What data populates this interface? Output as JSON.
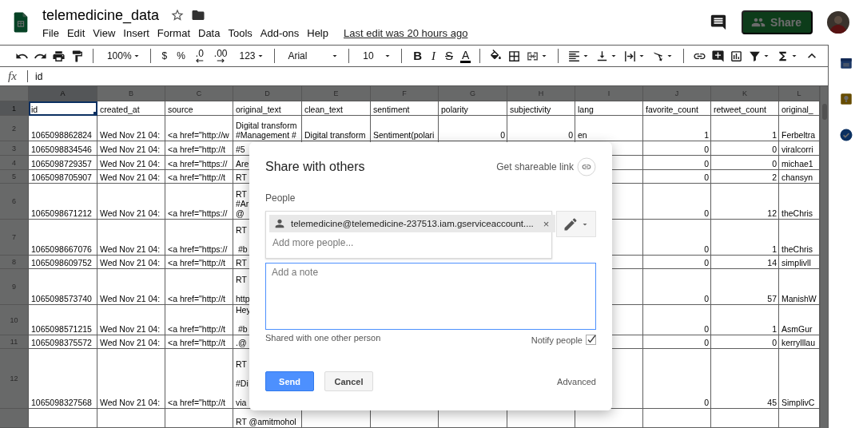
{
  "document": {
    "title": "telemedicine_data",
    "menus": [
      "File",
      "Edit",
      "View",
      "Insert",
      "Format",
      "Data",
      "Tools",
      "Add-ons",
      "Help"
    ],
    "last_edit": "Last edit was 20 hours ago",
    "share_label": "Share"
  },
  "toolbar": {
    "zoom": "100%",
    "currency": "$",
    "percent": "%",
    "decrease_decimals": ".0",
    "increase_decimals": ".00",
    "number_format": "123",
    "font": "Arial",
    "font_size": "10",
    "bold": "B",
    "italic": "I",
    "strikethrough": "S",
    "text_color": "A"
  },
  "formula_bar": {
    "fx": "fx",
    "value": "id"
  },
  "sheet": {
    "columns": [
      {
        "letter": "A",
        "selected": true,
        "kind": "text"
      },
      {
        "letter": "B",
        "selected": false,
        "kind": "text"
      },
      {
        "letter": "C",
        "selected": false,
        "kind": "text"
      },
      {
        "letter": "D",
        "selected": false,
        "kind": "text"
      },
      {
        "letter": "E",
        "selected": false,
        "kind": "text"
      },
      {
        "letter": "F",
        "selected": false,
        "kind": "text"
      },
      {
        "letter": "G",
        "selected": false,
        "kind": "number"
      },
      {
        "letter": "H",
        "selected": false,
        "kind": "number"
      },
      {
        "letter": "I",
        "selected": false,
        "kind": "text"
      },
      {
        "letter": "J",
        "selected": false,
        "kind": "number"
      },
      {
        "letter": "K",
        "selected": false,
        "kind": "number"
      },
      {
        "letter": "L",
        "selected": false,
        "kind": "text"
      }
    ],
    "rows": [
      {
        "number": "1",
        "selected": true,
        "kind": "header",
        "cells": [
          "id",
          "created_at",
          "source",
          "original_text",
          "clean_text",
          "sentiment",
          "polarity",
          "subjectivity",
          "lang",
          "favorite_count",
          "retweet_count",
          "original_"
        ]
      },
      {
        "number": "2",
        "selected": false,
        "kind": "data",
        "cells": [
          "1065098862824",
          "Wed Nov 21 04:",
          "<a href=\"http://w",
          "Digital transform\n#Management #",
          "Digital transform",
          "Sentiment(polari",
          "0",
          "0",
          "en",
          "1",
          "1",
          "Ferbeltra"
        ]
      },
      {
        "number": "3",
        "selected": false,
        "kind": "data",
        "cells": [
          "1065098834546",
          "Wed Nov 21 04:",
          "<a href=\"http://t",
          "#5",
          null,
          null,
          null,
          null,
          null,
          "0",
          "0",
          "viralcorri"
        ]
      },
      {
        "number": "4",
        "selected": false,
        "kind": "data",
        "cells": [
          "1065098729357",
          "Wed Nov 21 04:",
          "<a href=\"https://",
          "Are",
          null,
          null,
          null,
          null,
          null,
          "0",
          "0",
          "michae1"
        ]
      },
      {
        "number": "5",
        "selected": false,
        "kind": "data",
        "cells": [
          "1065098705907",
          "Wed Nov 21 04:",
          "<a href=\"http://t",
          "RT",
          null,
          null,
          null,
          null,
          null,
          "0",
          "2",
          "chansyn"
        ]
      },
      {
        "number": "6",
        "selected": false,
        "kind": "data",
        "cells": [
          "1065098671212",
          "Wed Nov 21 04:",
          "<a href=\"https://",
          "RT\n#Ar\n@",
          null,
          null,
          null,
          null,
          null,
          "0",
          "12",
          "theChris"
        ]
      },
      {
        "number": "7",
        "selected": false,
        "kind": "data",
        "cells": [
          "1065098667076",
          "Wed Nov 21 04:",
          "<a href=\"https://",
          "RT\n\n #b",
          null,
          null,
          null,
          null,
          null,
          "0",
          "1",
          "theChris"
        ]
      },
      {
        "number": "8",
        "selected": false,
        "kind": "data",
        "cells": [
          "1065098609752",
          "Wed Nov 21 04:",
          "<a href=\"http://t",
          "RT",
          null,
          null,
          null,
          null,
          null,
          "0",
          "14",
          "simplivll"
        ]
      },
      {
        "number": "9",
        "selected": false,
        "kind": "data",
        "cells": [
          "1065098573740",
          "Wed Nov 21 04:",
          "<a href=\"http://t",
          "RT\n\nhttp",
          null,
          null,
          null,
          null,
          null,
          "0",
          "57",
          "ManishW"
        ]
      },
      {
        "number": "10",
        "selected": false,
        "kind": "data",
        "cells": [
          "1065098571215",
          "Wed Nov 21 04:",
          "<a href=\"http://t",
          "Hey\n\n #b",
          null,
          null,
          null,
          null,
          null,
          "0",
          "1",
          "AsmGur"
        ]
      },
      {
        "number": "11",
        "selected": false,
        "kind": "data",
        "cells": [
          "1065098375572",
          "Wed Nov 21 04:",
          "<a href=\"http://t",
          ".@",
          null,
          null,
          null,
          null,
          null,
          "0",
          "0",
          "kerrylllau"
        ]
      },
      {
        "number": "12",
        "selected": false,
        "kind": "data",
        "cells": [
          "1065098327568",
          "Wed Nov 21 04:",
          "<a href=\"http://t",
          "RT\n\n#Di\n\nvia",
          null,
          null,
          null,
          null,
          null,
          "0",
          "45",
          "SimplivC"
        ]
      },
      {
        "kind": "data",
        "selected": false,
        "cells": [
          null,
          null,
          null,
          "RT @amitmohol",
          null,
          null,
          null,
          null,
          null,
          null,
          null,
          null
        ]
      }
    ]
  },
  "dialog": {
    "title": "Share with others",
    "shareable_link": "Get shareable link",
    "people_label": "People",
    "recipients": [
      {
        "email": "telemedicine@telemedicine-237513.iam.gserviceaccount....",
        "remove": "×"
      }
    ],
    "add_people_placeholder": "Add more people...",
    "note_placeholder": "Add a note",
    "note_focused": true,
    "shared_summary": "Shared with one other person",
    "notify_label": "Notify people",
    "notify_checked": true,
    "buttons": [
      {
        "label": "Send",
        "kind": "primary"
      },
      {
        "label": "Cancel",
        "kind": "secondary"
      }
    ],
    "advanced": "Advanced"
  }
}
